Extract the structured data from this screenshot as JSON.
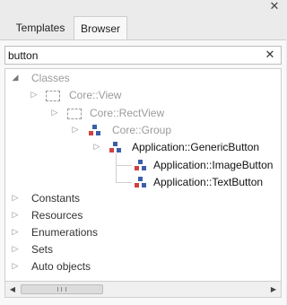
{
  "window": {
    "close_glyph": "✕",
    "close_icon": "close-icon"
  },
  "tabs": [
    {
      "label": "Templates",
      "active": false
    },
    {
      "label": "Browser",
      "active": true
    }
  ],
  "search": {
    "value": "button",
    "clear_glyph": "✕"
  },
  "tree": {
    "classes": {
      "label": "Classes",
      "expanded": true,
      "items": [
        {
          "label": "Core::View",
          "depth": 1,
          "matched": false,
          "icon": "dashed-box-icon"
        },
        {
          "label": "Core::RectView",
          "depth": 2,
          "matched": false,
          "icon": "dashed-box-icon"
        },
        {
          "label": "Core::Group",
          "depth": 3,
          "matched": false,
          "icon": "class-hierarchy-icon"
        },
        {
          "label": "Application::GenericButton",
          "depth": 4,
          "matched": true,
          "icon": "class-hierarchy-icon"
        },
        {
          "label": "Application::ImageButton",
          "depth": 5,
          "matched": true,
          "icon": "class-hierarchy-icon"
        },
        {
          "label": "Application::TextButton",
          "depth": 5,
          "matched": true,
          "icon": "class-hierarchy-icon"
        }
      ]
    },
    "sections": [
      {
        "label": "Constants"
      },
      {
        "label": "Resources"
      },
      {
        "label": "Enumerations"
      },
      {
        "label": "Sets"
      },
      {
        "label": "Auto objects"
      }
    ]
  },
  "scrollbar": {
    "left_glyph": "◀",
    "right_glyph": "▶",
    "thumb_glyph": "|||",
    "position": 0.0
  },
  "colors": {
    "panel_bg": "#f8f8f8",
    "chrome_bg": "#ebebeb",
    "icon_red": "#d0413f",
    "icon_blue": "#3a5fa8",
    "muted_text": "#9a9a9a"
  }
}
